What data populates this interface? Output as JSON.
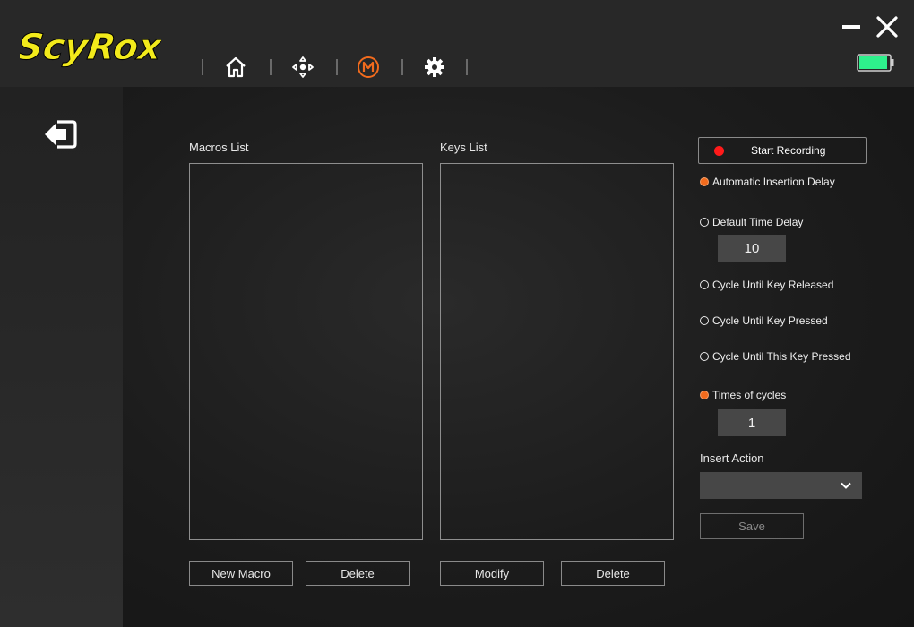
{
  "app": {
    "brand": "ScyRox",
    "brand_color": "#f2ea1b",
    "accent_color": "#f26b1d"
  },
  "nav": {
    "items": [
      {
        "id": "home",
        "icon": "home-icon"
      },
      {
        "id": "dpad",
        "icon": "direction-pad-icon"
      },
      {
        "id": "macro",
        "icon": "macro-m-icon",
        "active": true
      },
      {
        "id": "settings",
        "icon": "gear-icon"
      }
    ]
  },
  "window": {
    "battery_color": "#2ef08c"
  },
  "sidebar": {
    "back_icon": "exit-arrow-icon"
  },
  "macros": {
    "label": "Macros List",
    "items": [],
    "new_label": "New Macro",
    "delete_label": "Delete"
  },
  "keys": {
    "label": "Keys List",
    "items": [],
    "modify_label": "Modify",
    "delete_label": "Delete"
  },
  "recording": {
    "label": "Start Recording",
    "dot_color": "#ff1a1a"
  },
  "options": {
    "auto_delay": {
      "label": "Automatic Insertion Delay",
      "selected": true
    },
    "default_delay": {
      "label": "Default Time Delay",
      "selected": false,
      "value": "10"
    },
    "until_released": {
      "label": "Cycle Until Key Released",
      "selected": false
    },
    "until_pressed": {
      "label": "Cycle Until Key Pressed",
      "selected": false
    },
    "until_this_pressed": {
      "label": "Cycle Until This Key Pressed",
      "selected": false
    },
    "times_cycles": {
      "label": "Times of cycles",
      "selected": true,
      "value": "1"
    }
  },
  "insert_action": {
    "label": "Insert Action",
    "value": ""
  },
  "save_label": "Save"
}
